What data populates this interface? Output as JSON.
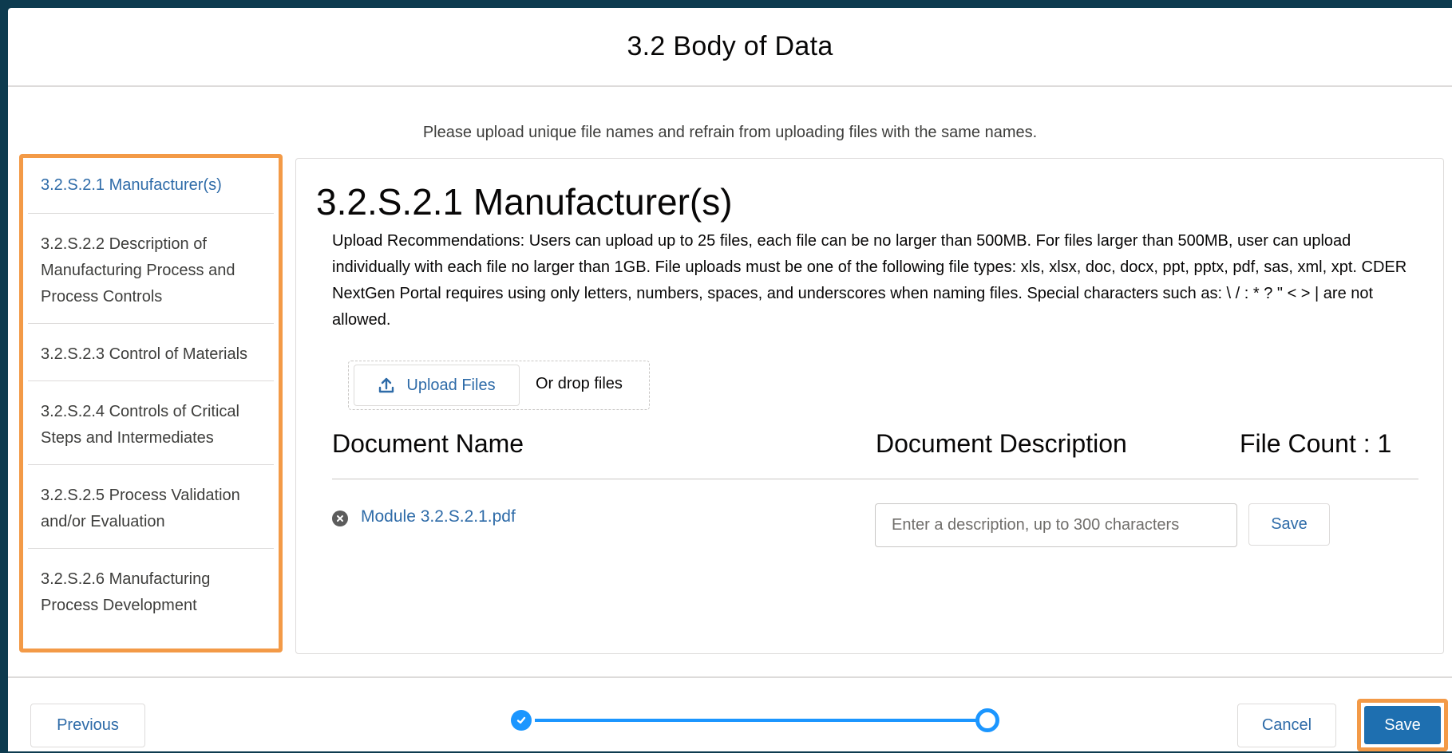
{
  "modal": {
    "title": "3.2 Body of Data",
    "notice": "Please upload unique file names and refrain from uploading files with the same names."
  },
  "sidebar": {
    "highlight_color": "#f39a47",
    "items": [
      {
        "label": "3.2.S.2.1 Manufacturer(s)",
        "active": true
      },
      {
        "label": "3.2.S.2.2 Description of Manufacturing Process and Process Controls",
        "active": false
      },
      {
        "label": "3.2.S.2.3 Control of Materials",
        "active": false
      },
      {
        "label": "3.2.S.2.4 Controls of Critical Steps and Intermediates",
        "active": false
      },
      {
        "label": "3.2.S.2.5 Process Validation and/or Evaluation",
        "active": false
      },
      {
        "label": "3.2.S.2.6 Manufacturing Process Development",
        "active": false
      }
    ]
  },
  "section": {
    "title": "3.2.S.2.1 Manufacturer(s)",
    "recommendations": "Upload Recommendations: Users can upload up to 25 files, each file can be no larger than 500MB. For files larger than 500MB, user can upload individually with each file no larger than 1GB. File uploads must be one of the following file types: xls, xlsx, doc, docx, ppt, pptx, pdf, sas, xml, xpt. CDER NextGen Portal requires using only letters, numbers, spaces, and underscores when naming files. Special characters such as: \\ / : * ? \" < > | are not allowed."
  },
  "upload": {
    "button_label": "Upload Files",
    "icon": "upload-icon",
    "drop_text": "Or drop files"
  },
  "table": {
    "col_name": "Document Name",
    "col_description": "Document Description",
    "file_count": "File Count : 1",
    "rows": [
      {
        "file_name": "Module 3.2.S.2.1.pdf",
        "description_placeholder": "Enter a description, up to 300 characters",
        "save_label": "Save"
      }
    ]
  },
  "footer": {
    "previous_label": "Previous",
    "cancel_label": "Cancel",
    "save_label": "Save",
    "progress_color": "#1b96ff",
    "save_color": "#1e6fb0"
  }
}
